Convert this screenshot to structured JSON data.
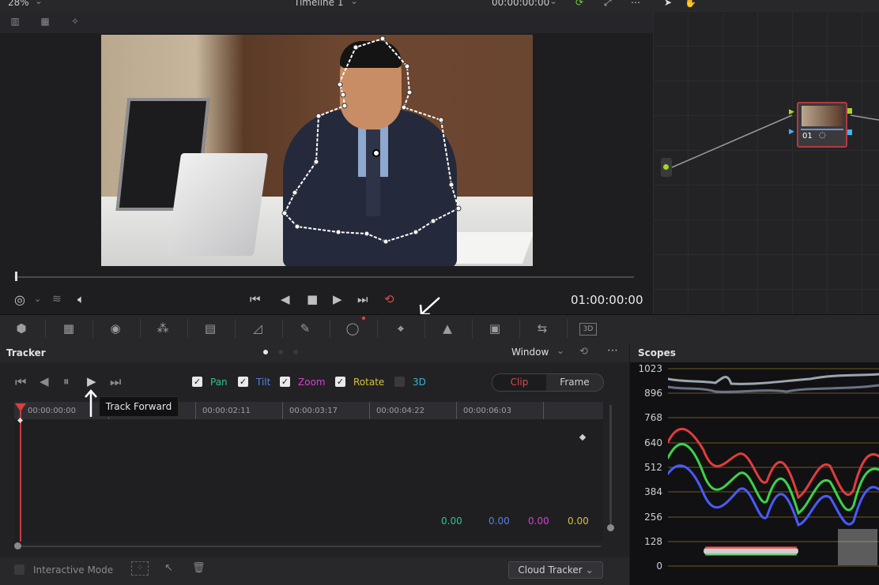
{
  "viewer": {
    "zoom": "28%",
    "title": "Timeline 1",
    "timecode_top": "00:00:00:00",
    "timecode": "01:00:00:00"
  },
  "node": {
    "label": "01"
  },
  "tracker": {
    "title": "Tracker",
    "mode": "Window",
    "checks": [
      {
        "label": "Pan",
        "checked": true,
        "color": "#2fc488"
      },
      {
        "label": "Tilt",
        "checked": true,
        "color": "#5a7fe0"
      },
      {
        "label": "Zoom",
        "checked": true,
        "color": "#d93ed3"
      },
      {
        "label": "Rotate",
        "checked": true,
        "color": "#d6c13c"
      },
      {
        "label": "3D",
        "checked": false,
        "color": "#36b6d8"
      }
    ],
    "segment": {
      "clip": "Clip",
      "frame": "Frame"
    },
    "ruler": [
      "00:00:00:00",
      "00:00:02:11",
      "00:00:03:17",
      "00:00:04:22",
      "00:00:06:03"
    ],
    "values": [
      "0.00",
      "0.00",
      "0.00",
      "0.00"
    ],
    "tooltip": "Track Forward",
    "interactive_mode": "Interactive Mode",
    "cloud_tracker": "Cloud Tracker"
  },
  "scopes": {
    "title": "Scopes",
    "scale": [
      "1023",
      "896",
      "768",
      "640",
      "512",
      "384",
      "256",
      "128",
      "0"
    ]
  }
}
